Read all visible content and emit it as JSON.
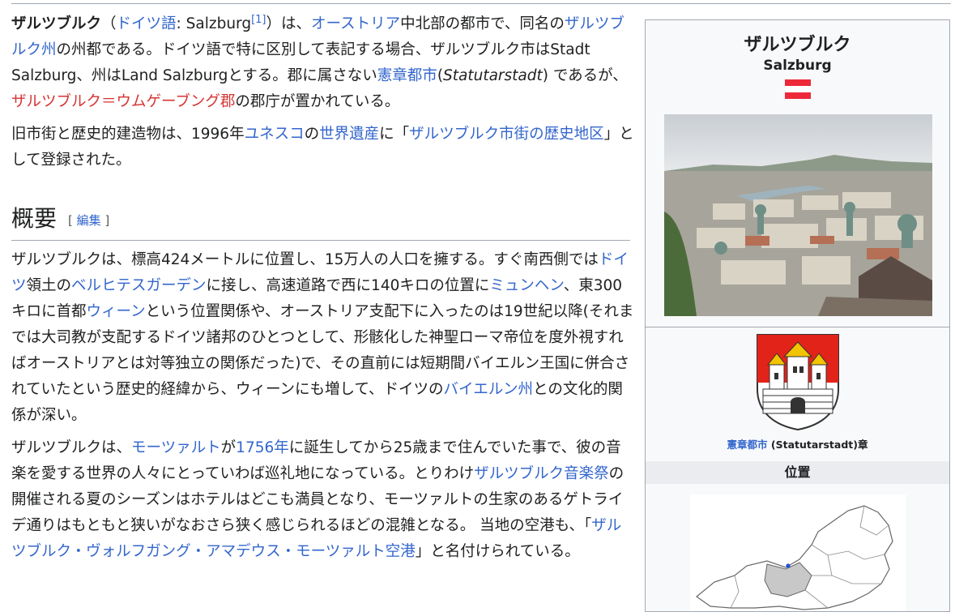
{
  "article": {
    "intro1": {
      "title_bold": "ザルツブルク",
      "paren_open": "（",
      "lang_link": "ドイツ語",
      "lang_rest": ": Salzburg",
      "ref": "[1]",
      "paren_close": "）は、",
      "austria_link": "オーストリア",
      "t1": "中北部の都市で、同名の",
      "state_link": "ザルツブルク州",
      "t2": "の州都である。ドイツ語で特に区別して表記する場合、ザルツブルク市はStadt Salzburg、州はLand Salzburgとする。郡に属さない",
      "statutory_link": "憲章都市",
      "t3": "(",
      "statutarstadt": "Statutarstadt",
      "t4": ") であるが、",
      "district_link": "ザルツブルク＝ウムゲーブング郡",
      "t5": "の郡庁が置かれている。"
    },
    "intro2": {
      "t1": "旧市街と歴史的建造物は、1996年",
      "unesco_link": "ユネスコ",
      "t2": "の",
      "heritage_link": "世界遺産",
      "t3": "に「",
      "historic_link": "ザルツブルク市街の歴史地区",
      "t4": "」として登録された。"
    },
    "section": {
      "heading": "概要",
      "edit_open": "[ ",
      "edit_label": "編集",
      "edit_close": " ]"
    },
    "para1": {
      "t1": "ザルツブルクは、標高424メートルに位置し、15万人の人口を擁する。すぐ南西側では",
      "germany_link": "ドイツ",
      "t2": "領土の",
      "berchtes_link": "ベルヒテスガーデン",
      "t3": "に接し、高速道路で西に140キロの位置に",
      "munich_link": "ミュンヘン",
      "t4": "、東300キロに首都",
      "vienna_link": "ウィーン",
      "t5": "という位置関係や、オーストリア支配下に入ったのは19世紀以降(それまでは大司教が支配するドイツ諸邦のひとつとして、形骸化した神聖ローマ帝位を度外視すればオーストリアとは対等独立の関係だった)で、その直前には短期間バイエルン王国に併合されていたという歴史的経緯から、ウィーンにも増して、ドイツの",
      "bavaria_link": "バイエルン州",
      "t6": "との文化的関係が深い。"
    },
    "para2": {
      "t1": "ザルツブルクは、",
      "mozart_link": "モーツァルト",
      "t2": "が",
      "year_link": "1756年",
      "t3": "に誕生してから25歳まで住んでいた事で、彼の音楽を愛する世界の人々にとっていわば巡礼地になっている。とりわけ",
      "festival_link": "ザルツブルク音楽祭",
      "t4": "の開催される夏のシーズンはホテルはどこも満員となり、モーツァルトの生家のあるゲトライデ通りはもともと狭いがなおさら狭く感じられるほどの混雑となる。 当地の空港も、「",
      "airport_link": "ザルツブルク・ヴォルフガング・アマデウス・モーツァルト空港",
      "t5": "」と名付けられている。"
    }
  },
  "infobox": {
    "title": "ザルツブルク",
    "subtitle": "Salzburg",
    "flag_colors": [
      "#ed2939",
      "#ffffff",
      "#ed2939"
    ],
    "coat_caption_link": "憲章都市",
    "coat_caption_rest": " (Statutarstadt)章",
    "location_header": "位置"
  },
  "colors": {
    "link": "#3366cc",
    "redlink": "#d73333",
    "text": "#202122",
    "border": "#a2a9b1"
  }
}
